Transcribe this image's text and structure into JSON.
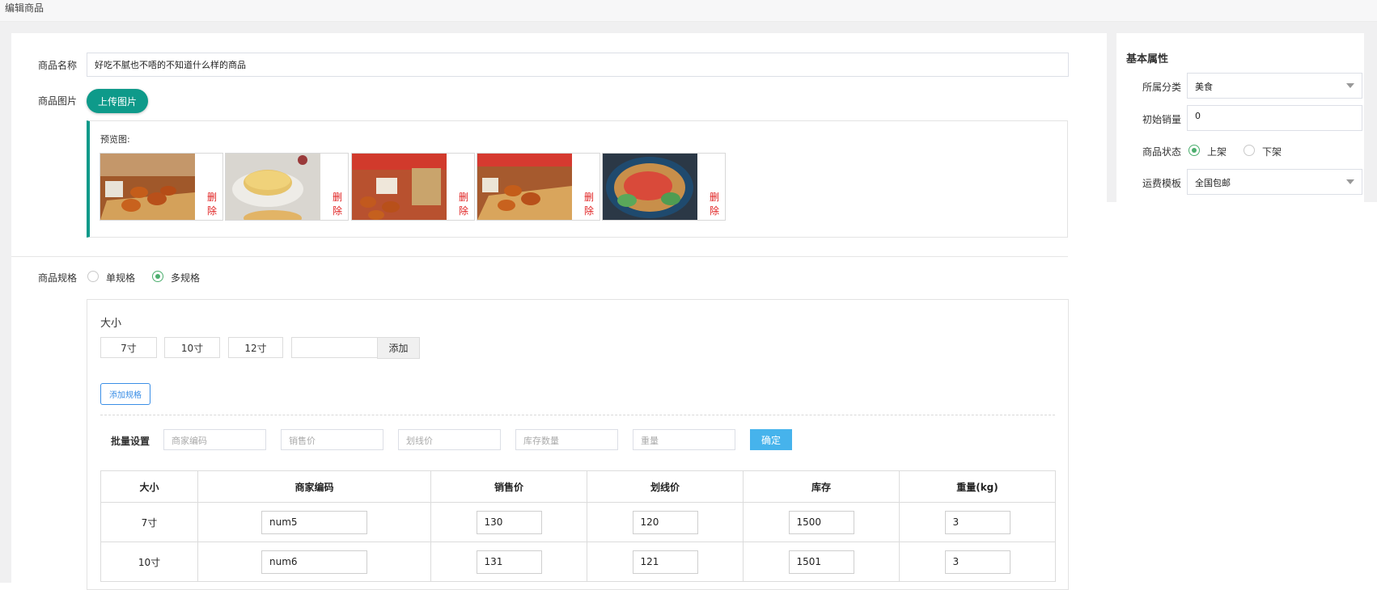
{
  "header": {
    "title": "编辑商品"
  },
  "form": {
    "name_label": "商品名称",
    "name_value": "好吃不腻也不唔的不知道什么样的商品",
    "image_label": "商品图片",
    "upload_label": "上传图片",
    "preview_title": "预览图:",
    "delete_label": "删除",
    "preview_images": [
      {
        "name": "product-image-1"
      },
      {
        "name": "product-image-2"
      },
      {
        "name": "product-image-3"
      },
      {
        "name": "product-image-4"
      },
      {
        "name": "product-image-5"
      }
    ],
    "spec_label": "商品规格",
    "spec_options": [
      {
        "label": "单规格",
        "selected": false
      },
      {
        "label": "多规格",
        "selected": true
      }
    ]
  },
  "spec_editor": {
    "group_name": "大小",
    "values": [
      "7寸",
      "10寸",
      "12寸"
    ],
    "new_value_placeholder": "",
    "add_label": "添加",
    "add_spec_label": "添加规格",
    "batch_label": "批量设置",
    "batch_placeholders": [
      "商家编码",
      "销售价",
      "划线价",
      "库存数量",
      "重量"
    ],
    "confirm_label": "确定"
  },
  "sku_table": {
    "headers": [
      "大小",
      "商家编码",
      "销售价",
      "划线价",
      "库存",
      "重量(kg)"
    ],
    "rows": [
      {
        "size": "7寸",
        "code": "num5",
        "price": "130",
        "list_price": "120",
        "stock": "1500",
        "weight": "3"
      },
      {
        "size": "10寸",
        "code": "num6",
        "price": "131",
        "list_price": "121",
        "stock": "1501",
        "weight": "3"
      }
    ]
  },
  "side": {
    "title": "基本属性",
    "category_label": "所属分类",
    "category_value": "美食",
    "initial_sales_label": "初始销量",
    "initial_sales_value": "0",
    "status_label": "商品状态",
    "status_options": [
      {
        "label": "上架",
        "selected": true
      },
      {
        "label": "下架",
        "selected": false
      }
    ],
    "shipping_label": "运费模板",
    "shipping_value": "全国包邮"
  },
  "colors": {
    "primary": "#0e9a8a",
    "danger": "#e02020",
    "info": "#46b3ec",
    "radio_active": "#4cae6e"
  }
}
